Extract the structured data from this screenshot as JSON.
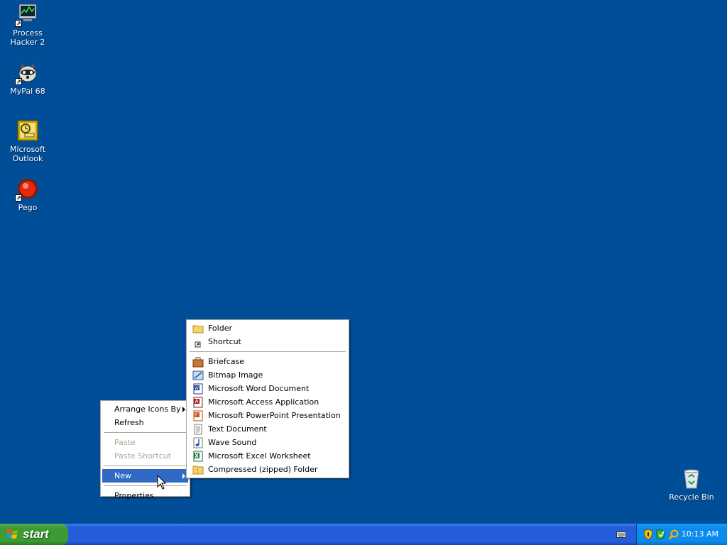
{
  "desktop": {
    "background": "#004E98",
    "icons": [
      {
        "label": "Process Hacker 2",
        "icon": "process-hacker-icon"
      },
      {
        "label": "MyPal 68",
        "icon": "mypal-icon"
      },
      {
        "label": "Microsoft Outlook",
        "icon": "outlook-icon"
      },
      {
        "label": "Pego",
        "icon": "pego-icon"
      },
      {
        "label": "Recycle Bin",
        "icon": "recycle-bin-icon"
      }
    ]
  },
  "context_menu": {
    "items": [
      {
        "label": "Arrange Icons By",
        "submenu": true
      },
      {
        "label": "Refresh"
      },
      {
        "label": "Paste",
        "disabled": true
      },
      {
        "label": "Paste Shortcut",
        "disabled": true
      },
      {
        "label": "New",
        "submenu": true,
        "selected": true
      },
      {
        "label": "Properties"
      }
    ]
  },
  "new_submenu": {
    "items": [
      {
        "label": "Folder",
        "icon": "folder-icon"
      },
      {
        "label": "Shortcut",
        "icon": "shortcut-icon"
      },
      {
        "label": "Briefcase",
        "icon": "briefcase-icon"
      },
      {
        "label": "Bitmap Image",
        "icon": "bitmap-icon"
      },
      {
        "label": "Microsoft Word Document",
        "icon": "word-icon"
      },
      {
        "label": "Microsoft Access Application",
        "icon": "access-icon"
      },
      {
        "label": "Microsoft PowerPoint Presentation",
        "icon": "powerpoint-icon"
      },
      {
        "label": "Text Document",
        "icon": "text-document-icon"
      },
      {
        "label": "Wave Sound",
        "icon": "wave-sound-icon"
      },
      {
        "label": "Microsoft Excel Worksheet",
        "icon": "excel-icon"
      },
      {
        "label": "Compressed (zipped) Folder",
        "icon": "zip-folder-icon"
      }
    ]
  },
  "taskbar": {
    "start_label": "start",
    "clock": "10:13 AM",
    "accent": "#245EDB",
    "start_color": "#3C9B35"
  }
}
